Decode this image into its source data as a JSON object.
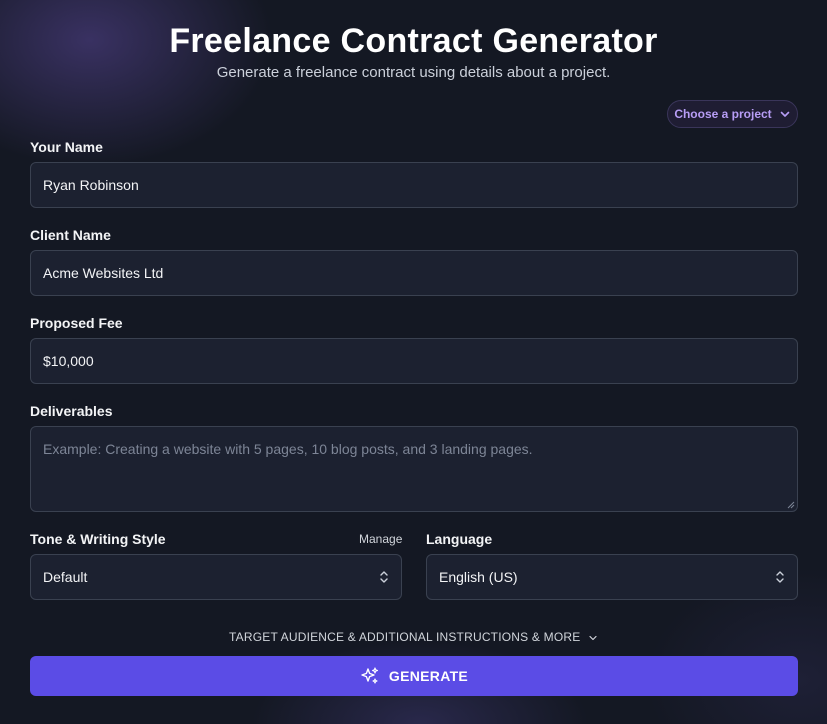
{
  "header": {
    "title": "Freelance Contract Generator",
    "subtitle": "Generate a freelance contract using details about a project."
  },
  "project_selector": {
    "label": "Choose a project",
    "icon": "chevron-down-icon"
  },
  "form": {
    "your_name": {
      "label": "Your Name",
      "value": "Ryan Robinson"
    },
    "client_name": {
      "label": "Client Name",
      "value": "Acme Websites Ltd"
    },
    "proposed_fee": {
      "label": "Proposed Fee",
      "value": "$10,000"
    },
    "deliverables": {
      "label": "Deliverables",
      "placeholder": "Example: Creating a website with 5 pages, 10 blog posts, and 3 landing pages.",
      "value": ""
    },
    "tone": {
      "label": "Tone & Writing Style",
      "manage_label": "Manage",
      "selected": "Default"
    },
    "language": {
      "label": "Language",
      "selected": "English (US)"
    }
  },
  "advanced_toggle": {
    "label": "TARGET AUDIENCE & ADDITIONAL INSTRUCTIONS & MORE"
  },
  "generate_button": {
    "label": "GENERATE",
    "icon": "sparkles-icon",
    "color": "#5b4ce6"
  },
  "colors": {
    "accent": "#5b4ce6",
    "chip_text": "#b79df5",
    "background": "#141823"
  }
}
